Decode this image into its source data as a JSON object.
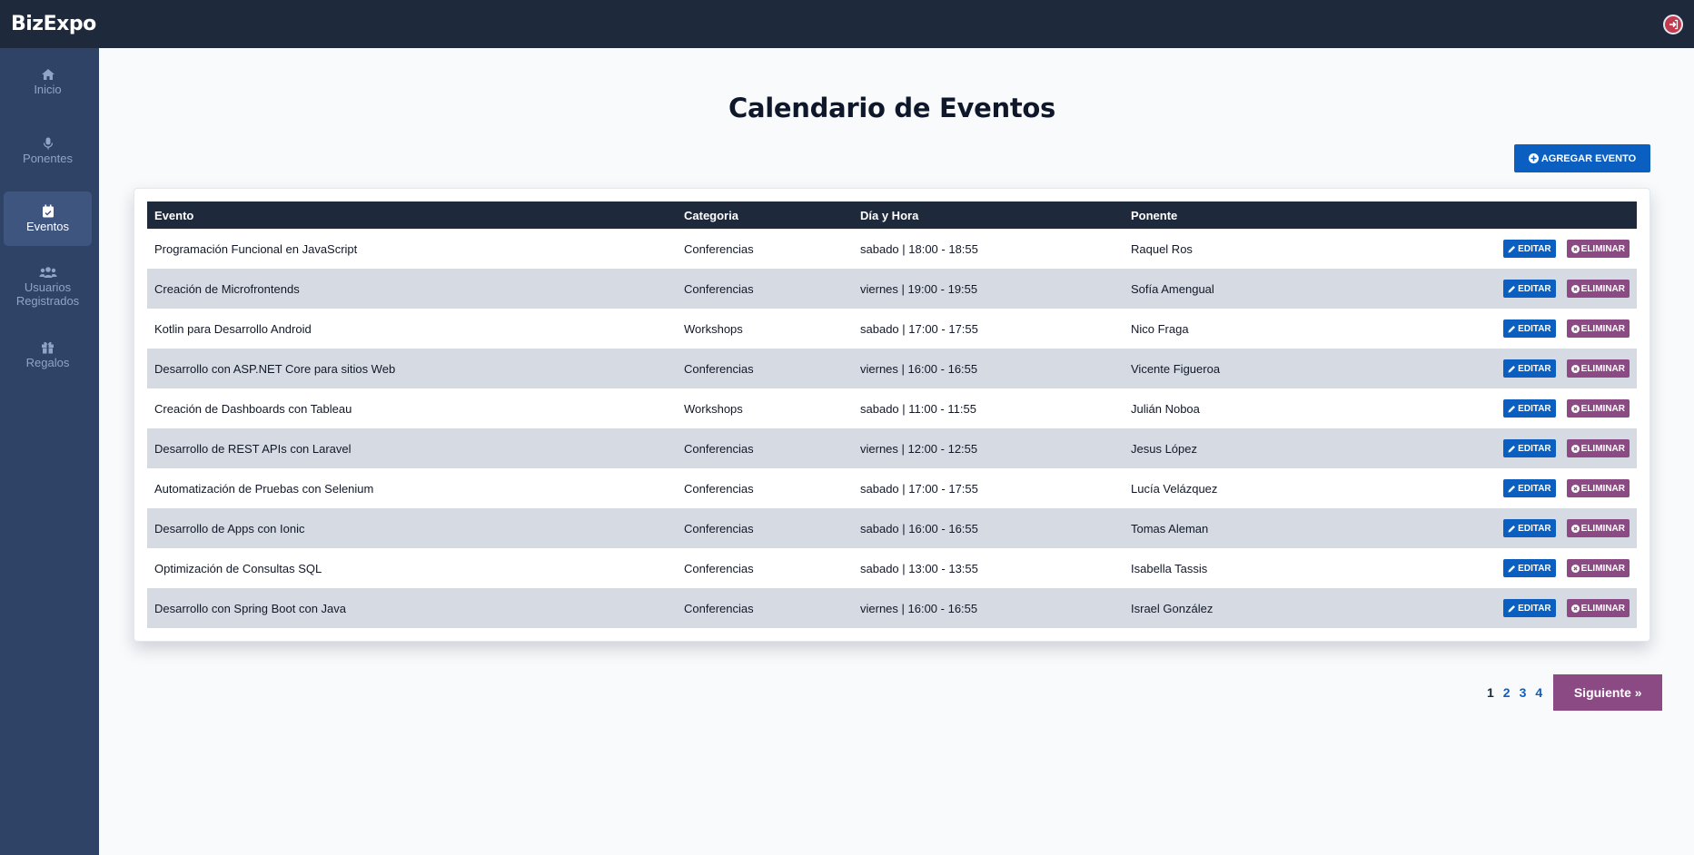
{
  "app": {
    "brand": "BizExpo"
  },
  "sidebar": {
    "items": [
      {
        "label": "Inicio",
        "icon": "home-icon",
        "active": false
      },
      {
        "label": "Ponentes",
        "icon": "microphone-icon",
        "active": false
      },
      {
        "label": "Eventos",
        "icon": "calendar-icon",
        "active": true
      },
      {
        "label": "Usuarios Registrados",
        "icon": "users-icon",
        "active": false
      },
      {
        "label": "Regalos",
        "icon": "gift-icon",
        "active": false
      }
    ]
  },
  "main": {
    "title": "Calendario de Eventos",
    "add_button": "AGREGAR EVENTO",
    "table": {
      "headers": {
        "evento": "Evento",
        "categoria": "Categoria",
        "dia_hora": "Día y Hora",
        "ponente": "Ponente"
      },
      "edit_label": "EDITAR",
      "delete_label": "ELIMINAR",
      "rows": [
        {
          "evento": "Programación Funcional en JavaScript",
          "categoria": "Conferencias",
          "dia_hora": "sabado | 18:00 - 18:55",
          "ponente": "Raquel Ros"
        },
        {
          "evento": "Creación de Microfrontends",
          "categoria": "Conferencias",
          "dia_hora": "viernes | 19:00 - 19:55",
          "ponente": "Sofía Amengual"
        },
        {
          "evento": "Kotlin para Desarrollo Android",
          "categoria": "Workshops",
          "dia_hora": "sabado | 17:00 - 17:55",
          "ponente": "Nico Fraga"
        },
        {
          "evento": "Desarrollo con ASP.NET Core para sitios Web",
          "categoria": "Conferencias",
          "dia_hora": "viernes | 16:00 - 16:55",
          "ponente": "Vicente Figueroa"
        },
        {
          "evento": "Creación de Dashboards con Tableau",
          "categoria": "Workshops",
          "dia_hora": "sabado | 11:00 - 11:55",
          "ponente": "Julián Noboa"
        },
        {
          "evento": "Desarrollo de REST APIs con Laravel",
          "categoria": "Conferencias",
          "dia_hora": "viernes | 12:00 - 12:55",
          "ponente": "Jesus López"
        },
        {
          "evento": "Automatización de Pruebas con Selenium",
          "categoria": "Conferencias",
          "dia_hora": "sabado | 17:00 - 17:55",
          "ponente": "Lucía Velázquez"
        },
        {
          "evento": "Desarrollo de Apps con Ionic",
          "categoria": "Conferencias",
          "dia_hora": "sabado | 16:00 - 16:55",
          "ponente": "Tomas Aleman"
        },
        {
          "evento": "Optimización de Consultas SQL",
          "categoria": "Conferencias",
          "dia_hora": "sabado | 13:00 - 13:55",
          "ponente": "Isabella Tassis"
        },
        {
          "evento": "Desarrollo con Spring Boot con Java",
          "categoria": "Conferencias",
          "dia_hora": "viernes | 16:00 - 16:55",
          "ponente": "Israel González"
        }
      ]
    },
    "pagination": {
      "pages": [
        "1",
        "2",
        "3",
        "4"
      ],
      "current": "1",
      "next_label": "Siguiente »"
    }
  },
  "colors": {
    "topbar": "#1e293b",
    "sidebar": "#2e4365",
    "primary": "#0b5fc1",
    "danger": "#8c4a84"
  }
}
